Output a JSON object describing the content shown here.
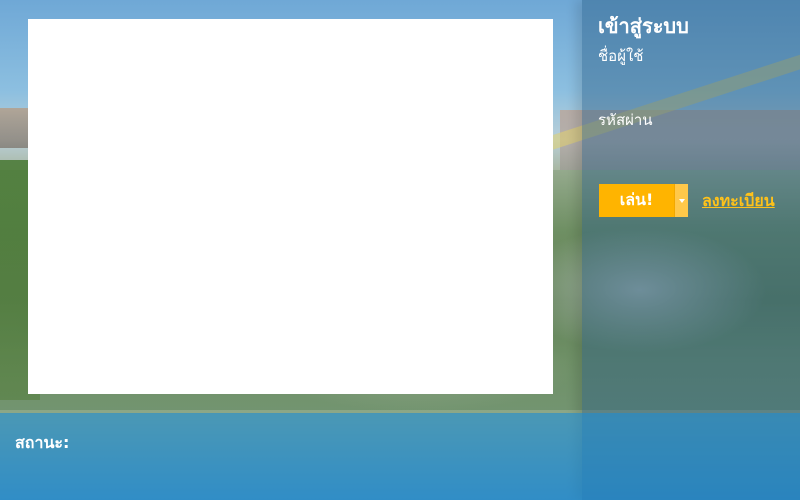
{
  "login": {
    "title": "เข้าสู่ระบบ",
    "username_label": "ชื่อผู้ใช้",
    "username_value": "",
    "password_label": "รหัสผ่าน",
    "password_value": "",
    "play_label": "เล่น!",
    "play_dropdown_icon": "chevron-down-icon",
    "register_label": "ลงทะเบียน"
  },
  "status": {
    "label": "สถานะ:"
  },
  "colors": {
    "accent": "#ffb400",
    "link": "#ffc21a",
    "status_bar": "#1e8cd2"
  }
}
